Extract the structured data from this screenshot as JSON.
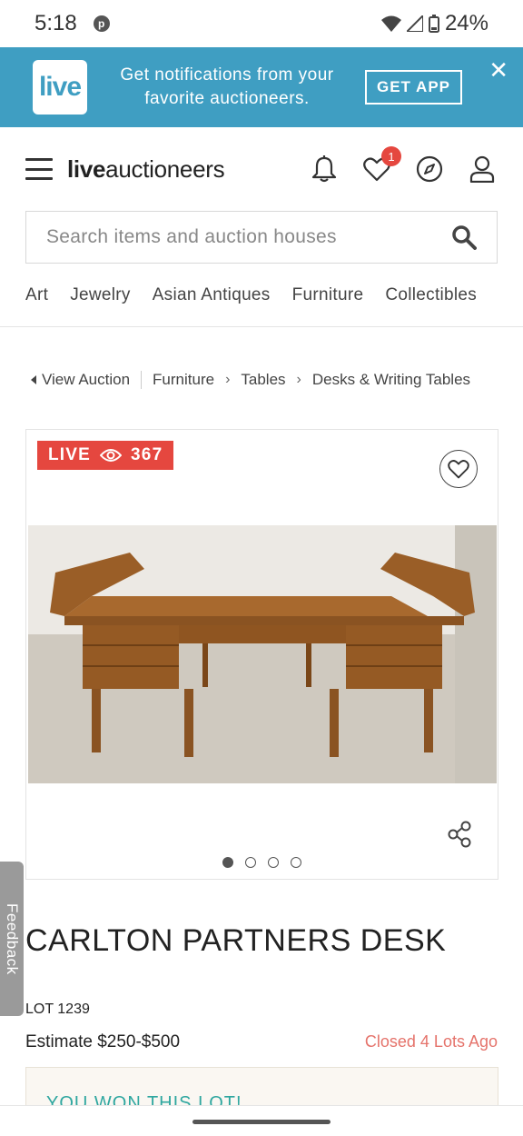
{
  "status_bar": {
    "time": "5:18",
    "battery": "24%"
  },
  "promo": {
    "logo_text": "live",
    "message": "Get notifications from your favorite auctioneers.",
    "cta": "GET APP",
    "close": "✕"
  },
  "header": {
    "brand_bold": "live",
    "brand_rest": "auctioneers",
    "favorites_count": "1"
  },
  "search": {
    "placeholder": "Search items and auction houses"
  },
  "categories": [
    "Art",
    "Jewelry",
    "Asian Antiques",
    "Furniture",
    "Collectibles"
  ],
  "breadcrumb": {
    "back": "View Auction",
    "items": [
      "Furniture",
      "Tables",
      "Desks & Writing Tables"
    ]
  },
  "item": {
    "live_label": "LIVE",
    "viewers": "367",
    "title": "CARLTON PARTNERS DESK",
    "lot": "LOT 1239",
    "estimate": "Estimate $250-$500",
    "status": "Closed 4 Lots Ago",
    "won_banner": "YOU WON THIS LOT!",
    "image_count": 4,
    "active_image": 1
  },
  "feedback": "Feedback",
  "colors": {
    "brand_blue": "#3f9ec2",
    "live_red": "#e5473f",
    "closed_text": "#e5736b",
    "won_text": "#2fa7a0"
  }
}
